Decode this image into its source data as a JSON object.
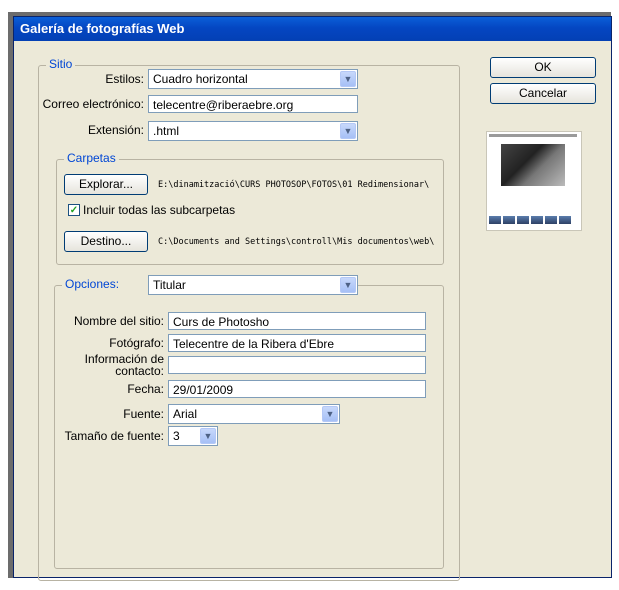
{
  "window": {
    "title": "Galería de fotografías Web"
  },
  "buttons": {
    "ok": "OK",
    "cancel": "Cancelar",
    "browse": "Explorar...",
    "destination": "Destino..."
  },
  "sitio": {
    "legend": "Sitio",
    "styles_label": "Estilos:",
    "styles_value": "Cuadro horizontal",
    "email_label": "Correo electrónico:",
    "email_value": "telecentre@riberaebre.org",
    "extension_label": "Extensión:",
    "extension_value": ".html"
  },
  "carpetas": {
    "legend": "Carpetas",
    "source_path": "E:\\dinamització\\CURS PHOTOSOP\\FOTOS\\01 Redimensionar\\",
    "include_subfolders_label": "Incluir todas las subcarpetas",
    "include_subfolders_checked": true,
    "destination_path": "C:\\Documents and Settings\\controll\\Mis documentos\\web\\"
  },
  "opciones": {
    "legend": "Opciones:",
    "selected": "Titular",
    "site_name_label": "Nombre del sitio:",
    "site_name_value": "Curs de Photosho",
    "photographer_label": "Fotógrafo:",
    "photographer_value": "Telecentre de la Ribera d'Ebre",
    "contact_label_1": "Información de",
    "contact_label_2": "contacto:",
    "contact_value": "",
    "date_label": "Fecha:",
    "date_value": "29/01/2009",
    "font_label": "Fuente:",
    "font_value": "Arial",
    "font_size_label": "Tamaño de fuente:",
    "font_size_value": "3"
  },
  "icons": {
    "dropdown": "chevron-down-icon",
    "checkmark": "checkmark-icon"
  },
  "colors": {
    "titlebar": "#0446c2",
    "dialog_bg": "#ece9d8",
    "legend_text": "#0046d5",
    "field_border": "#7f9db9"
  }
}
